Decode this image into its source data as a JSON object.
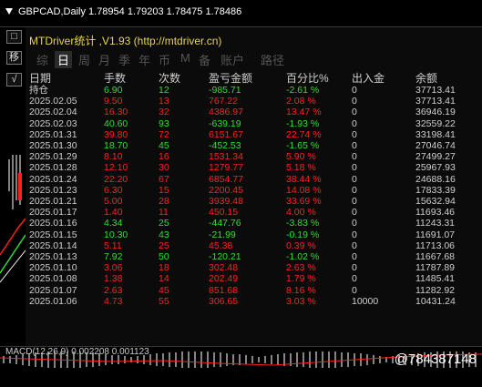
{
  "topbar": {
    "symbol": "GBPCAD,Daily  1.78954 1.79203 1.78475 1.78486"
  },
  "panel": {
    "title": "MTDriver统计 ,V1.93 (http://mtdriver.cn)",
    "left_buttons": [
      "□",
      "移",
      "√"
    ],
    "tabs": [
      "综",
      "日",
      "周",
      "月",
      "季",
      "年",
      "币",
      "M",
      "备",
      "账户",
      "路径"
    ],
    "active_tab_index": 1
  },
  "table": {
    "headers": [
      "日期",
      "手数",
      "次数",
      "盈亏金额",
      "百分比%",
      "出入金",
      "余额"
    ],
    "rows": [
      {
        "date": "持仓",
        "lots": "6.90",
        "count": "12",
        "pl": "-985.71",
        "pct": "-2.61 %",
        "io": "0",
        "bal": "37713.41",
        "color": "g"
      },
      {
        "date": "2025.02.05",
        "lots": "9.50",
        "count": "13",
        "pl": "767.22",
        "pct": "2.08 %",
        "io": "0",
        "bal": "37713.41",
        "color": "r"
      },
      {
        "date": "2025.02.04",
        "lots": "16.30",
        "count": "32",
        "pl": "4386.97",
        "pct": "13.47 %",
        "io": "0",
        "bal": "36946.19",
        "color": "r"
      },
      {
        "date": "2025.02.03",
        "lots": "40.60",
        "count": "93",
        "pl": "-639.19",
        "pct": "-1.93 %",
        "io": "0",
        "bal": "32559.22",
        "color": "g"
      },
      {
        "date": "2025.01.31",
        "lots": "39.80",
        "count": "72",
        "pl": "6151.67",
        "pct": "22.74 %",
        "io": "0",
        "bal": "33198.41",
        "color": "r"
      },
      {
        "date": "2025.01.30",
        "lots": "18.70",
        "count": "45",
        "pl": "-452.53",
        "pct": "-1.65 %",
        "io": "0",
        "bal": "27046.74",
        "color": "g"
      },
      {
        "date": "2025.01.29",
        "lots": "8.10",
        "count": "16",
        "pl": "1531.34",
        "pct": "5.90 %",
        "io": "0",
        "bal": "27499.27",
        "color": "r"
      },
      {
        "date": "2025.01.28",
        "lots": "12.10",
        "count": "30",
        "pl": "1279.77",
        "pct": "5.18 %",
        "io": "0",
        "bal": "25967.93",
        "color": "r"
      },
      {
        "date": "2025.01.24",
        "lots": "22.20",
        "count": "67",
        "pl": "6854.77",
        "pct": "38.44 %",
        "io": "0",
        "bal": "24688.16",
        "color": "r"
      },
      {
        "date": "2025.01.23",
        "lots": "6.30",
        "count": "15",
        "pl": "2200.45",
        "pct": "14.08 %",
        "io": "0",
        "bal": "17833.39",
        "color": "r"
      },
      {
        "date": "2025.01.21",
        "lots": "5.00",
        "count": "28",
        "pl": "3939.48",
        "pct": "33.69 %",
        "io": "0",
        "bal": "15632.94",
        "color": "r"
      },
      {
        "date": "2025.01.17",
        "lots": "1.40",
        "count": "11",
        "pl": "450.15",
        "pct": "4.00 %",
        "io": "0",
        "bal": "11693.46",
        "color": "r"
      },
      {
        "date": "2025.01.16",
        "lots": "4.34",
        "count": "25",
        "pl": "-447.76",
        "pct": "-3.83 %",
        "io": "0",
        "bal": "11243.31",
        "color": "g"
      },
      {
        "date": "2025.01.15",
        "lots": "10.30",
        "count": "43",
        "pl": "-21.99",
        "pct": "-0.19 %",
        "io": "0",
        "bal": "11691.07",
        "color": "g"
      },
      {
        "date": "2025.01.14",
        "lots": "5.11",
        "count": "25",
        "pl": "45.38",
        "pct": "0.39 %",
        "io": "0",
        "bal": "11713.06",
        "color": "r"
      },
      {
        "date": "2025.01.13",
        "lots": "7.92",
        "count": "50",
        "pl": "-120.21",
        "pct": "-1.02 %",
        "io": "0",
        "bal": "11667.68",
        "color": "g"
      },
      {
        "date": "2025.01.10",
        "lots": "3.06",
        "count": "18",
        "pl": "302.48",
        "pct": "2.63 %",
        "io": "0",
        "bal": "11787.89",
        "color": "r"
      },
      {
        "date": "2025.01.08",
        "lots": "1.38",
        "count": "14",
        "pl": "202.49",
        "pct": "1.79 %",
        "io": "0",
        "bal": "11485.41",
        "color": "r"
      },
      {
        "date": "2025.01.07",
        "lots": "2.63",
        "count": "45",
        "pl": "851.68",
        "pct": "8.16 %",
        "io": "0",
        "bal": "11282.92",
        "color": "r"
      },
      {
        "date": "2025.01.06",
        "lots": "4.73",
        "count": "55",
        "pl": "306.65",
        "pct": "3.03 %",
        "io": "10000",
        "bal": "10431.24",
        "color": "r"
      }
    ]
  },
  "indicator": {
    "label": "MACD(12,26,9) 0.002208 0.001123"
  },
  "watermark": "@784387148",
  "colors": {
    "profit": "#ff2020",
    "loss": "#2fe02f",
    "title": "#e8d44d"
  }
}
